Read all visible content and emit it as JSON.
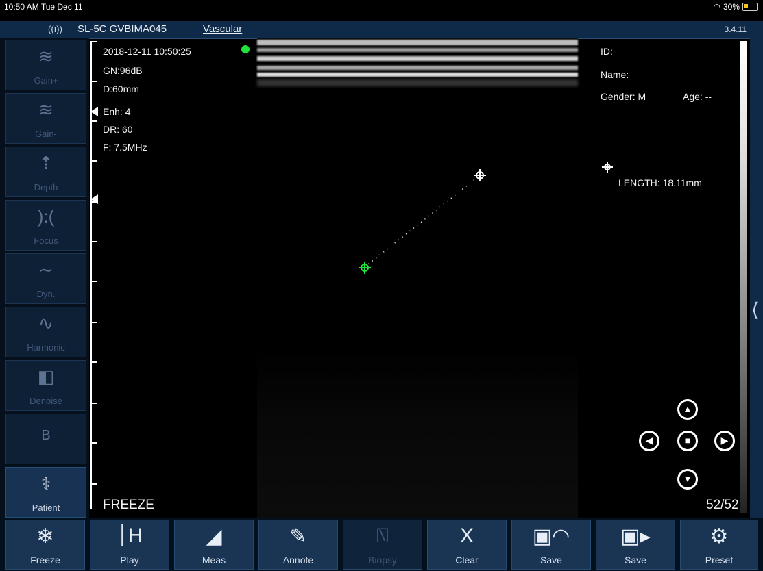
{
  "status_bar": {
    "time": "10:50 AM  Tue Dec 11",
    "battery": "30%"
  },
  "header": {
    "wifi_icon": "wifi-signal-icon",
    "device": "SL-5C GVBIMA045",
    "mode": "Vascular",
    "version": "3.4.11"
  },
  "left_buttons": [
    {
      "label": "Gain+",
      "icon": "gain-up-icon",
      "glyph": "≋"
    },
    {
      "label": "Gain-",
      "icon": "gain-down-icon",
      "glyph": "≋"
    },
    {
      "label": "Depth",
      "icon": "depth-icon",
      "glyph": "⇡"
    },
    {
      "label": "Focus",
      "icon": "focus-icon",
      "glyph": "):("
    },
    {
      "label": "Dyn.",
      "icon": "dynamic-range-icon",
      "glyph": "∼"
    },
    {
      "label": "Harmonic",
      "icon": "harmonic-icon",
      "glyph": "∿"
    },
    {
      "label": "Denoise",
      "icon": "denoise-icon",
      "glyph": "◧"
    },
    {
      "label": "",
      "icon": "b-mode-icon",
      "glyph": "B"
    },
    {
      "label": "Patient",
      "icon": "patient-icon",
      "glyph": "⚕"
    }
  ],
  "image_info": {
    "datetime": "2018-12-11 10:50:25",
    "gain": "GN:96dB",
    "depth": "D:60mm",
    "enhance": "Enh: 4",
    "dynamic_range": "DR: 60",
    "frequency": "F: 7.5MHz"
  },
  "patient_info": {
    "id": "ID:",
    "name": "Name:",
    "gender": "Gender: M",
    "age": "Age: --"
  },
  "measurement": {
    "length": "LENGTH: 18.11mm"
  },
  "freeze_label": "FREEZE",
  "frame_counter": "52/52",
  "colors": {
    "accent": "#1a3554",
    "green_marker": "#22e33a"
  },
  "bottom_buttons": [
    {
      "label": "Freeze",
      "icon": "snowflake-icon",
      "glyph": "❄",
      "disabled": false
    },
    {
      "label": "Play",
      "icon": "play-cine-icon",
      "glyph": "⏐H",
      "disabled": false
    },
    {
      "label": "Meas",
      "icon": "ruler-icon",
      "glyph": "◢",
      "disabled": false
    },
    {
      "label": "Annote",
      "icon": "annotate-icon",
      "glyph": "✎",
      "disabled": false
    },
    {
      "label": "Biopsy",
      "icon": "biopsy-icon",
      "glyph": "⍂",
      "disabled": true
    },
    {
      "label": "Clear",
      "icon": "clear-x-icon",
      "glyph": "X",
      "disabled": false
    },
    {
      "label": "Save",
      "icon": "save-image-icon",
      "glyph": "▣◠",
      "disabled": false
    },
    {
      "label": "Save",
      "icon": "save-video-icon",
      "glyph": "▣▸",
      "disabled": false
    },
    {
      "label": "Preset",
      "icon": "gear-icon",
      "glyph": "⚙",
      "disabled": false
    }
  ]
}
